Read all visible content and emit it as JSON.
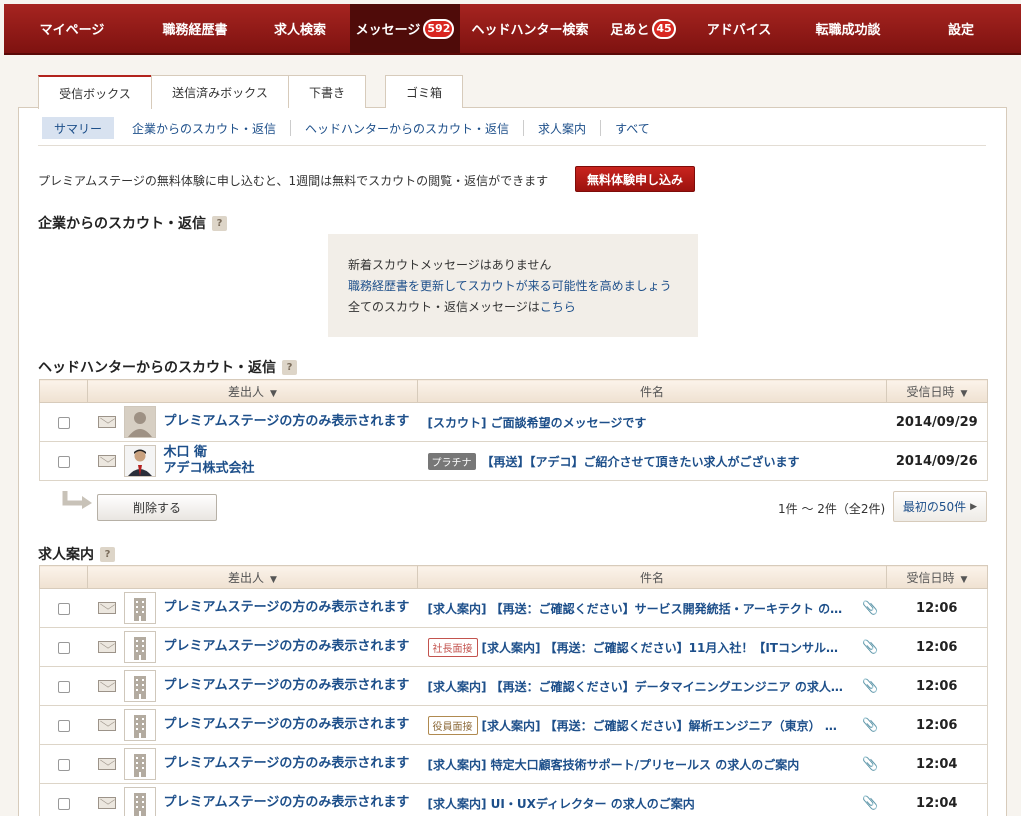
{
  "nav": {
    "items": [
      {
        "label": "マイページ"
      },
      {
        "label": "職務経歴書"
      },
      {
        "label": "求人検索"
      },
      {
        "label": "メッセージ",
        "badge": "592"
      },
      {
        "label": "ヘッドハンター検索"
      },
      {
        "label": "足あと",
        "badge": "45"
      },
      {
        "label": "アドバイス"
      },
      {
        "label": "転職成功談"
      },
      {
        "label": "設定"
      }
    ]
  },
  "tabs": [
    "受信ボックス",
    "送信済みボックス",
    "下書き",
    "ゴミ箱"
  ],
  "subnav": [
    "サマリー",
    "企業からのスカウト・返信",
    "ヘッドハンターからのスカウト・返信",
    "求人案内",
    "すべて"
  ],
  "promo": {
    "text": "プレミアムステージの無料体験に申し込むと、1週間は無料でスカウトの閲覧・返信ができます",
    "button": "無料体験申し込み"
  },
  "company_section": {
    "title": "企業からのスカウト・返信",
    "help": "?",
    "notice_line1": "新着スカウトメッセージはありません",
    "notice_line2": "職務経歴書を更新してスカウトが来る可能性を高めましょう",
    "notice_line3_prefix": "全てのスカウト・返信メッセージは",
    "notice_line3_link": "こちら"
  },
  "headhunter_section": {
    "title": "ヘッドハンターからのスカウト・返信",
    "help": "?",
    "col_sender": "差出人",
    "col_subject": "件名",
    "col_date": "受信日時",
    "rows": [
      {
        "sender": "プレミアムステージの方のみ表示されます",
        "sender_company": "",
        "tag": "",
        "subject": "[スカウト] ご面談希望のメッセージです",
        "date": "2014/09/29"
      },
      {
        "sender": "木口 衛",
        "sender_company": "アデコ株式会社",
        "tag": "プラチナ",
        "subject": "【再送】【アデコ】ご紹介させて頂きたい求人がございます",
        "date": "2014/09/26"
      }
    ],
    "delete_button": "削除する",
    "pager_text": "1件 〜 2件（全2件)",
    "pager_button": "最初の50件"
  },
  "jobs_section": {
    "title": "求人案内",
    "help": "?",
    "col_sender": "差出人",
    "col_subject": "件名",
    "col_date": "受信日時",
    "rows": [
      {
        "sender": "プレミアムステージの方のみ表示されます",
        "tag": "",
        "subject": "[求人案内] 【再送：ご確認ください】サービス開発統括・アーキテクト の…",
        "date": "12:06"
      },
      {
        "sender": "プレミアムステージの方のみ表示されます",
        "tag": "社長面接",
        "subject": "[求人案内] 【再送：ご確認ください】11月入社！【ITコンサル…",
        "date": "12:06"
      },
      {
        "sender": "プレミアムステージの方のみ表示されます",
        "tag": "",
        "subject": "[求人案内] 【再送：ご確認ください】データマイニングエンジニア の求人…",
        "date": "12:06"
      },
      {
        "sender": "プレミアムステージの方のみ表示されます",
        "tag": "役員面接",
        "subject": "[求人案内] 【再送：ご確認ください】解析エンジニア（東京） …",
        "date": "12:06"
      },
      {
        "sender": "プレミアムステージの方のみ表示されます",
        "tag": "",
        "subject": "[求人案内] 特定大口顧客技術サポート/プリセールス の求人のご案内",
        "date": "12:04"
      },
      {
        "sender": "プレミアムステージの方のみ表示されます",
        "tag": "",
        "subject": "[求人案内] UI・UXディレクター の求人のご案内",
        "date": "12:04"
      }
    ]
  }
}
